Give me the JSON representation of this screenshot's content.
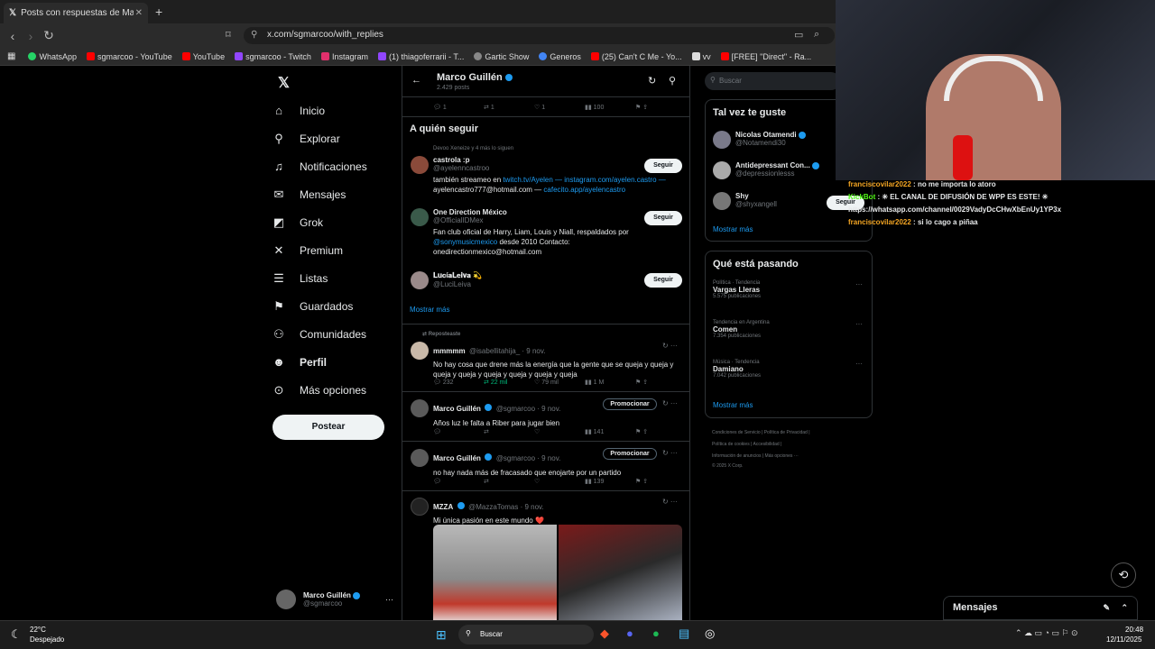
{
  "browser": {
    "tab_title": "Posts con respuestas de Marco G",
    "url": "x.com/sgmarcoo/with_replies",
    "bookmarks": [
      "WhatsApp",
      "sgmarcoo - YouTube",
      "YouTube",
      "sgmarcoo - Twitch",
      "Instagram",
      "(1) thiagoferrarii - T...",
      "Gartic Show",
      "Generos",
      "(25) Can't C Me - Yo...",
      "vv",
      "[FREE] \"Direct\" - Ra..."
    ]
  },
  "nav": {
    "items": [
      "Inicio",
      "Explorar",
      "Notificaciones",
      "Mensajes",
      "Grok",
      "Premium",
      "Listas",
      "Guardados",
      "Comunidades",
      "Perfil",
      "Más opciones"
    ],
    "icons": [
      "home-icon",
      "search-icon",
      "bell-icon",
      "mail-icon",
      "grok-icon",
      "x-icon",
      "list-icon",
      "bookmark-icon",
      "people-icon",
      "person-icon",
      "more-icon"
    ],
    "post_label": "Postear",
    "account_name": "Marco Guillén",
    "account_handle": "@sgmarcoo"
  },
  "header": {
    "name": "Marco Guillén",
    "posts": "2.429 posts"
  },
  "top_actions": {
    "reply": "1",
    "repost": "1",
    "like": "1",
    "views": "100"
  },
  "who_to_follow": {
    "title": "A quién seguir",
    "context": "Devoo Xeneize y 4 más lo siguen",
    "follow_label": "Seguir",
    "show_more": "Mostrar más",
    "users": [
      {
        "name": "castrola :p",
        "handle": "@ayelenncastroo",
        "bio_1": "también streameo en ",
        "bio_link": "twitch.tv/Ayelen — instagram.com/ayelen.castro —",
        "bio_2": "ayelencastro777@hotmail.com — ",
        "bio_link2": "cafecito.app/ayelencastro"
      },
      {
        "name": "One Direction México",
        "handle": "@OfficialIDMex",
        "bio_1": "Fan club oficial de Harry, Liam, Louis y Niall, respaldados por",
        "bio_link": "@sonymusicmexico",
        "bio_2": " desde 2010 Contacto:",
        "bio_3": "onedirectionmexico@hotmail.com"
      },
      {
        "name": "𝐋𝐮𝐜í𝐚𝐋𝐞𝐢𝐯𝐚 💫",
        "handle": "@LuciLeiva"
      }
    ]
  },
  "posts": [
    {
      "repost_label": "Reposteaste",
      "name": "mmmmm",
      "handle": "@isabellitahija_ · 9 nov.",
      "text": "No hay cosa que drene más la energía que la gente que se queja y queja y queja y queja y queja y queja y queja y queja",
      "reply": "232",
      "repost": "22 mil",
      "like": "79 mil",
      "views": "1 M"
    },
    {
      "name": "Marco Guillén",
      "handle": "@sgmarcoo · 9 nov.",
      "promo": "Promocionar",
      "text": "Años luz le falta a Riber para jugar bien",
      "views": "141"
    },
    {
      "name": "Marco Guillén",
      "handle": "@sgmarcoo · 9 nov.",
      "promo": "Promocionar",
      "text": "no hay nada más de fracasado que enojarte por un partido",
      "views": "139"
    },
    {
      "name": "MZZA",
      "handle": "@MazzaTomas · 9 nov.",
      "text": "Mi única pasión en este mundo ❤️"
    }
  ],
  "right": {
    "search_placeholder": "Buscar",
    "suggest_title": "Tal vez te guste",
    "suggest": [
      {
        "name": "Nicolas Otamendi",
        "handle": "@Notamendi30"
      },
      {
        "name": "Antidepressant Con...",
        "handle": "@depressionlesss"
      },
      {
        "name": "Shy",
        "handle": "@shyxangell"
      }
    ],
    "follow_label": "Seguir",
    "show_more": "Mostrar más",
    "trends_title": "Qué está pasando",
    "trends": [
      {
        "meta": "Política · Tendencia",
        "name": "Vargas Lleras",
        "count": "5.575 publicaciones"
      },
      {
        "meta": "Tendencia en Argentina",
        "name": "Comen",
        "count": "7.354 publicaciones"
      },
      {
        "meta": "Música · Tendencia",
        "name": "Damiano",
        "count": "7.042 publicaciones"
      }
    ],
    "footer_1": "Condiciones de Servicio  |  Política de Privacidad  |",
    "footer_2": "Política de cookies  |  Accesibilidad  |",
    "footer_3": "Información de anuncios  |  Más opciones ···",
    "footer_4": "© 2025 X Corp.",
    "messages": "Mensajes"
  },
  "chat": [
    {
      "user": "franciscovilar2022",
      "text": " : no me importa lo atoro"
    },
    {
      "user": "KickBot",
      "text": " : ✳ EL CANAL DE DIFUSIÓN DE WPP ES ESTE! ✳ https://whatsapp.com/channel/0029VadyDcCHwXbEnUy1YP3x"
    },
    {
      "user": "franciscovilar2022",
      "text": " : si lo cago a piñaa"
    }
  ],
  "taskbar": {
    "weather_temp": "22°C",
    "weather_desc": "Despejado",
    "search": "Buscar",
    "time": "20:48",
    "date": "12/11/2025"
  },
  "colors": {
    "accent": "#1d9bf0",
    "chat_user": "#f5a623",
    "kickbot": "#53fc18"
  }
}
